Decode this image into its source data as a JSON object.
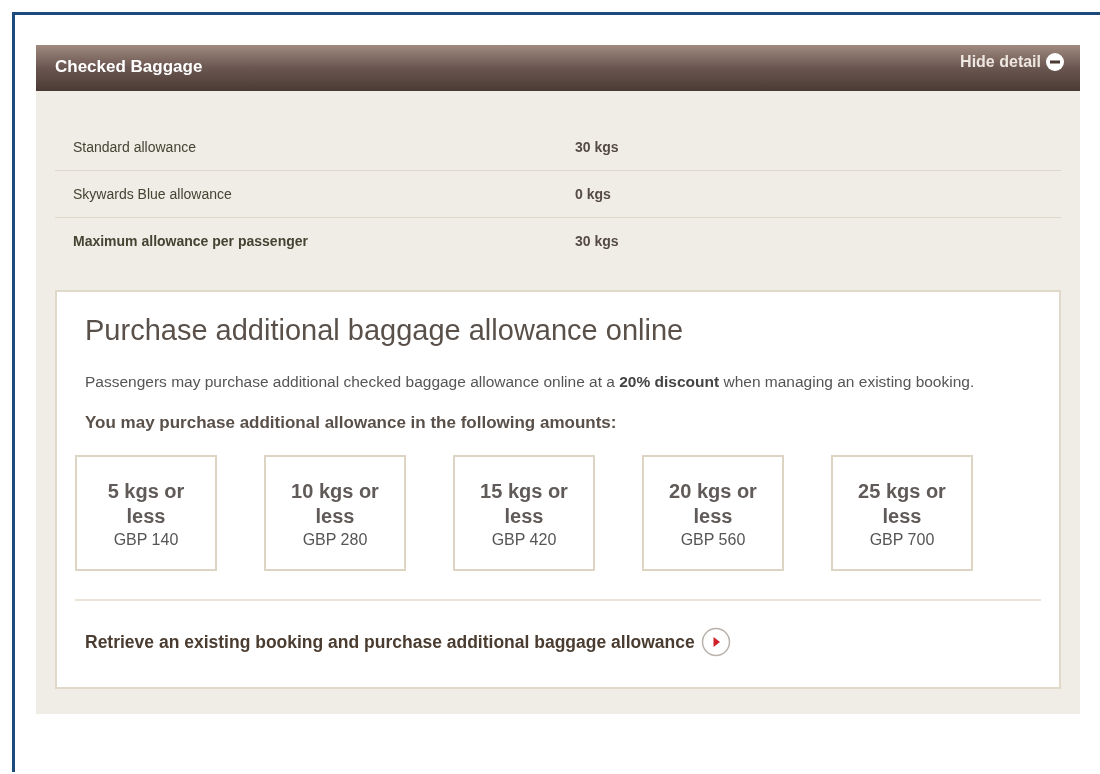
{
  "panel": {
    "title": "Checked Baggage",
    "toggle": {
      "label": "Hide detail",
      "expanded": true
    }
  },
  "allowances": [
    {
      "label": "Standard allowance",
      "value": "30 kgs",
      "emphasis": false
    },
    {
      "label": "Skywards Blue allowance",
      "value": "0 kgs",
      "emphasis": false
    },
    {
      "label": "Maximum allowance per passenger",
      "value": "30 kgs",
      "emphasis": true
    }
  ],
  "purchase": {
    "heading": "Purchase additional baggage allowance online",
    "text": "Passengers may purchase additional checked baggage allowance online at a **20% discount** when managing an existing booking.",
    "subheading": "You may purchase additional allowance in the following amounts:",
    "options": [
      {
        "amount": "5 kgs or less",
        "price": "GBP 140"
      },
      {
        "amount": "10 kgs or less",
        "price": "GBP 280"
      },
      {
        "amount": "15 kgs or less",
        "price": "GBP 420"
      },
      {
        "amount": "20 kgs or less",
        "price": "GBP 560"
      },
      {
        "amount": "25 kgs or less",
        "price": "GBP 700"
      }
    ],
    "link": "Retrieve an existing booking and purchase additional baggage allowance"
  }
}
